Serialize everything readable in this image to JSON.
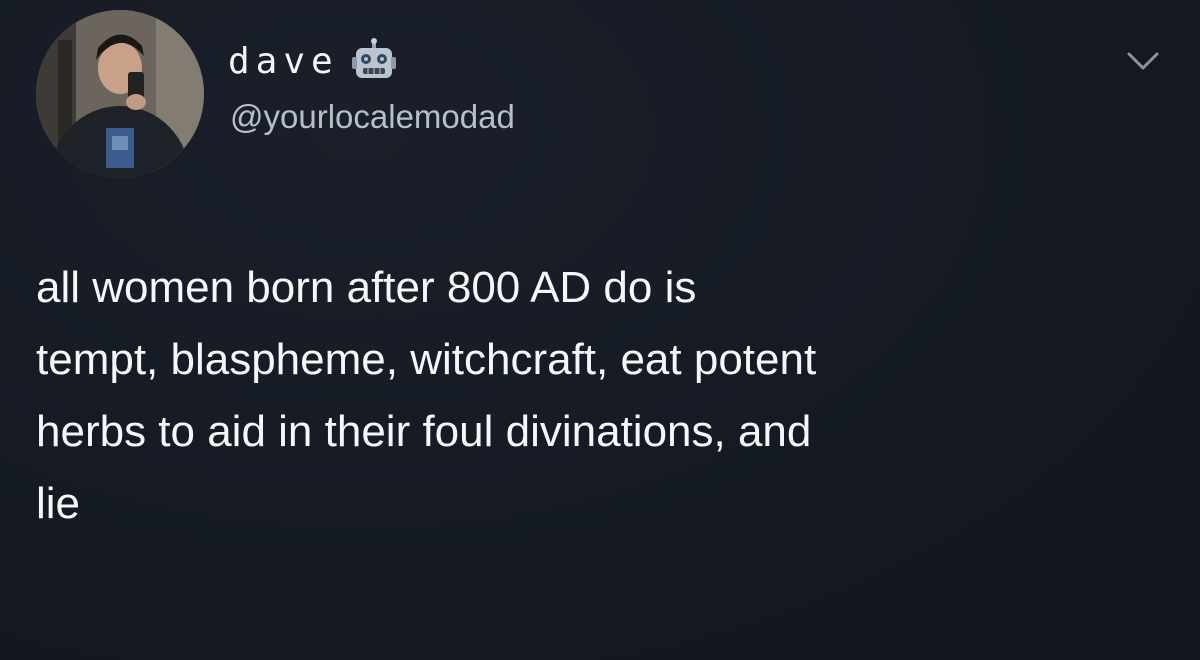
{
  "user": {
    "display_name": "dave",
    "handle": "@yourlocalemodad",
    "name_emoji_icon": "robot-icon"
  },
  "menu": {
    "icon": "chevron-down-icon"
  },
  "tweet": {
    "lines": [
      "all women born after 800 AD do is",
      "tempt, blaspheme, witchcraft, eat potent",
      "herbs to aid in their foul divinations, and",
      "lie"
    ]
  },
  "colors": {
    "background": "#151a22",
    "text": "#f4f6f8",
    "handle": "#b7bfc8"
  }
}
